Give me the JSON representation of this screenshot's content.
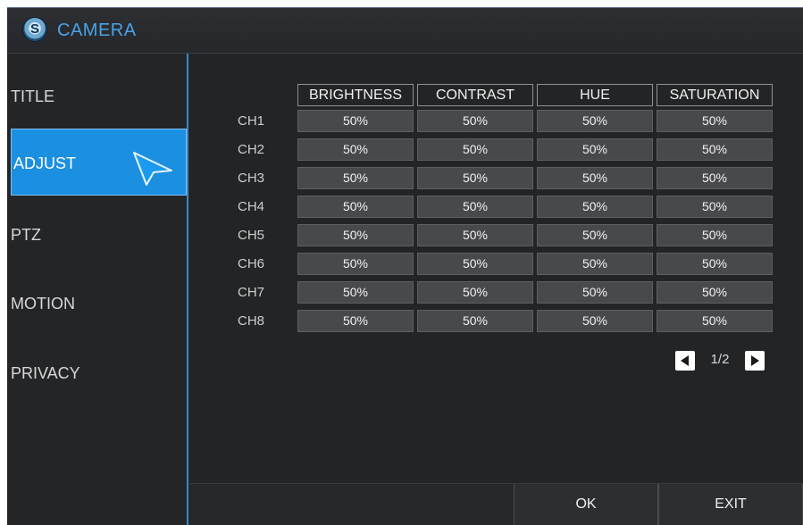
{
  "window": {
    "title": "CAMERA"
  },
  "sidebar": {
    "items": [
      {
        "label": "TITLE",
        "active": false
      },
      {
        "label": "ADJUST",
        "active": true
      },
      {
        "label": "PTZ",
        "active": false
      },
      {
        "label": "MOTION",
        "active": false
      },
      {
        "label": "PRIVACY",
        "active": false
      }
    ]
  },
  "table": {
    "columns": [
      "BRIGHTNESS",
      "CONTRAST",
      "HUE",
      "SATURATION"
    ],
    "rows": [
      {
        "channel": "CH1",
        "values": [
          "50%",
          "50%",
          "50%",
          "50%"
        ]
      },
      {
        "channel": "CH2",
        "values": [
          "50%",
          "50%",
          "50%",
          "50%"
        ]
      },
      {
        "channel": "CH3",
        "values": [
          "50%",
          "50%",
          "50%",
          "50%"
        ]
      },
      {
        "channel": "CH4",
        "values": [
          "50%",
          "50%",
          "50%",
          "50%"
        ]
      },
      {
        "channel": "CH5",
        "values": [
          "50%",
          "50%",
          "50%",
          "50%"
        ]
      },
      {
        "channel": "CH6",
        "values": [
          "50%",
          "50%",
          "50%",
          "50%"
        ]
      },
      {
        "channel": "CH7",
        "values": [
          "50%",
          "50%",
          "50%",
          "50%"
        ]
      },
      {
        "channel": "CH8",
        "values": [
          "50%",
          "50%",
          "50%",
          "50%"
        ]
      }
    ]
  },
  "pager": {
    "text": "1/2",
    "prev_icon": "triangle-left-icon",
    "next_icon": "triangle-right-icon"
  },
  "footer": {
    "ok_label": "OK",
    "exit_label": "EXIT"
  },
  "colors": {
    "accent": "#1b8fe0",
    "title_text": "#4aa3e6",
    "divider": "#3f86c4"
  }
}
